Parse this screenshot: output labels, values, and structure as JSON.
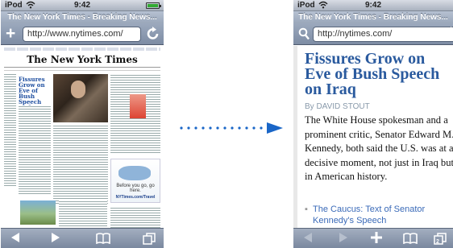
{
  "left": {
    "status": {
      "carrier": "iPod",
      "time": "9:42"
    },
    "title": "The New York Times - Breaking News...",
    "url": "http://www.nytimes.com/",
    "masthead": "The New York Times",
    "thumb_headline": "Fissures Grow on Eve of Bush Speech on Iraq",
    "ad_text": "Before you go, go here.",
    "ad_link": "NYTimes.com/Travel",
    "toolbar": [
      "back-icon",
      "forward-icon",
      "bookmarks-icon",
      "pages-icon"
    ]
  },
  "right": {
    "status": {
      "carrier": "iPod",
      "time": "9:42"
    },
    "title": "The New York Times - Breaking News...",
    "url": "http://nytimes.com/",
    "headline": "Fissures Grow on Eve of Bush Speech on Iraq",
    "byline": "By DAVID STOUT",
    "body": "The White House spokesman and a prominent critic, Senator Edward M. Kennedy, both said the U.S. was at a decisive moment, not just in Iraq but in American history.",
    "related_link": "The Caucus: Text of Senator Kennedy's Speech",
    "pages_count": "2",
    "toolbar": [
      "back-icon",
      "forward-icon",
      "add-icon",
      "bookmarks-icon",
      "pages-icon"
    ]
  },
  "colors": {
    "headline_blue": "#2a5a9e",
    "arrow_blue": "#1a66c7",
    "toolbar": "#8795ab"
  }
}
